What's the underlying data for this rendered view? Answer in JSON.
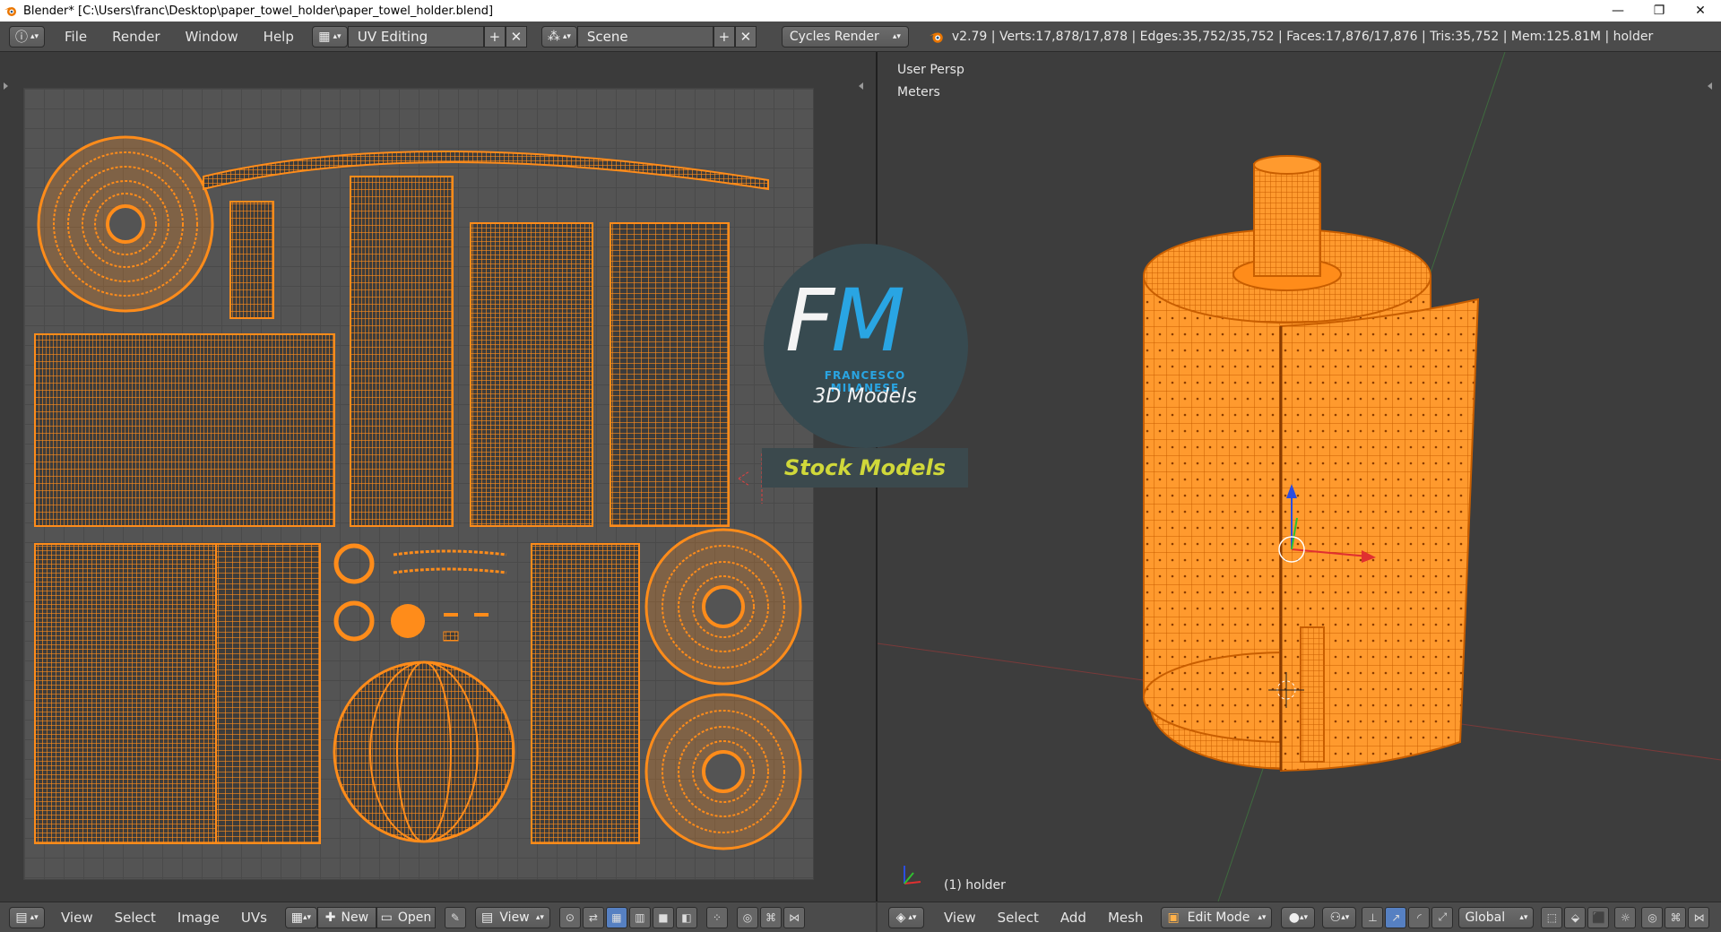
{
  "window": {
    "title": "Blender* [C:\\Users\\franc\\Desktop\\paper_towel_holder\\paper_towel_holder.blend]",
    "minimize": "—",
    "restore": "❐",
    "close": "✕"
  },
  "info_header": {
    "info_icon": "ⓘ",
    "menus": [
      "File",
      "Render",
      "Window",
      "Help"
    ],
    "screen_layout": "UV Editing",
    "scene": "Scene",
    "render_engine": "Cycles Render",
    "stats": "v2.79 | Verts:17,878/17,878 | Edges:35,752/35,752 | Faces:17,876/17,876 | Tris:35,752 | Mem:125.81M | holder"
  },
  "viewport": {
    "view_name": "User Persp",
    "units": "Meters",
    "object_label": "(1) holder"
  },
  "watermark": {
    "letter_f": "F",
    "letter_m": "M",
    "author": "FRANCESCO MILANESE",
    "subtitle": "3D Models",
    "banner": "Stock Models"
  },
  "uv_header": {
    "menus": [
      "View",
      "Select",
      "Image",
      "UVs"
    ],
    "new_label": "New",
    "open_label": "Open",
    "view_label": "View"
  },
  "viewport_header": {
    "menus": [
      "View",
      "Select",
      "Add",
      "Mesh"
    ],
    "mode": "Edit Mode",
    "orientation": "Global"
  },
  "colors": {
    "mesh_orange": "#ff8c1a",
    "mesh_wire": "#c85e00",
    "accent_blue": "#29a5e3",
    "banner_yellow": "#d0d83a"
  }
}
